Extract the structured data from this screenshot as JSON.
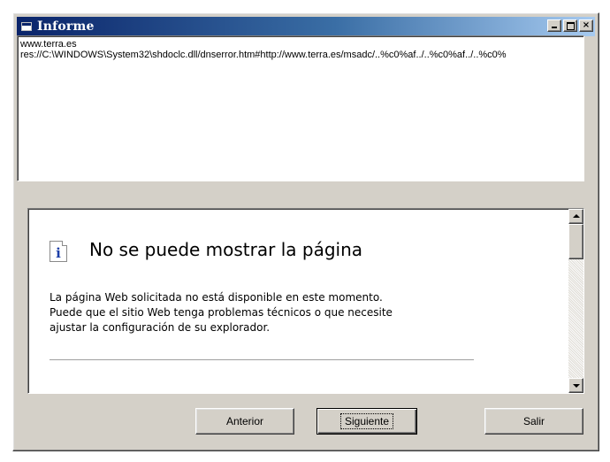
{
  "window": {
    "title": "Informe",
    "controls": {
      "minimize": "_",
      "maximize": "□",
      "close": "×"
    }
  },
  "report": {
    "lines": [
      "www.terra.es",
      "res://C:\\WINDOWS\\System32\\shdoclc.dll/dnserror.htm#http://www.terra.es/msadc/..%c0%af../..%c0%af../..%c0%"
    ]
  },
  "browser": {
    "icon": "info-icon",
    "icon_glyph": "i",
    "heading": "No se puede mostrar la página",
    "body_lines": [
      "La página Web solicitada no está disponible en este momento.",
      "Puede que el sitio Web tenga problemas técnicos o que necesite",
      "ajustar la configuración de su explorador."
    ]
  },
  "buttons": {
    "previous": "Anterior",
    "next": "Siguiente",
    "exit": "Salir"
  },
  "colors": {
    "title_gradient_start": "#0a246a",
    "title_gradient_end": "#a6caf0",
    "face": "#d4d0c8",
    "info_icon": "#1c3fa8"
  }
}
